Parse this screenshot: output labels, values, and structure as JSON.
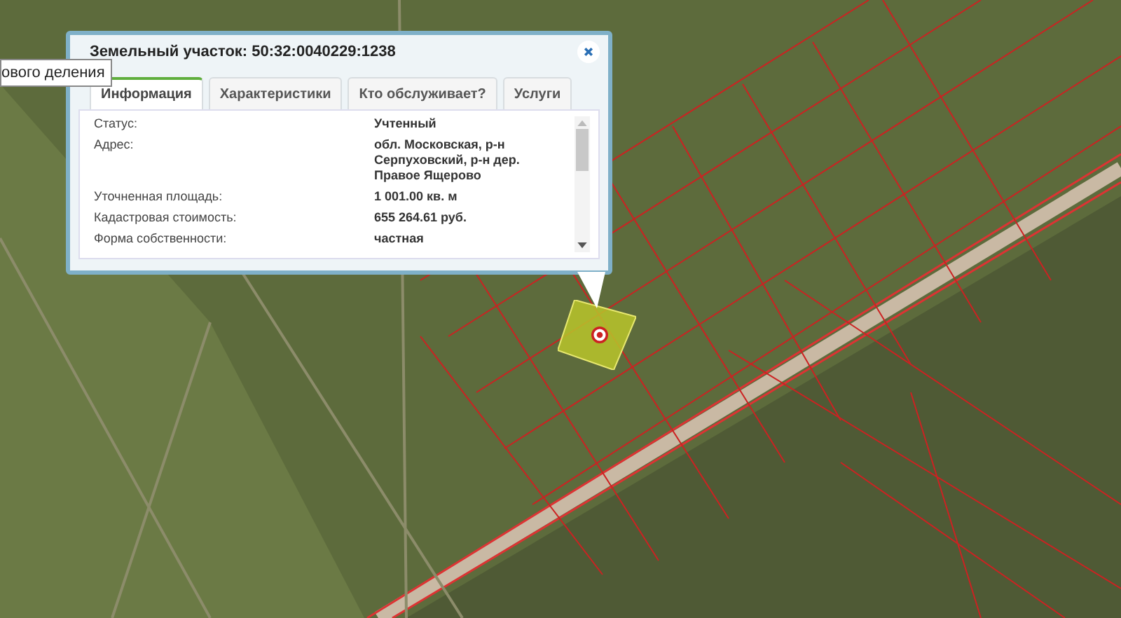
{
  "map_tooltip": {
    "text": "ового деления"
  },
  "popup": {
    "title": "Земельный участок: 50:32:0040229:1238",
    "tabs": [
      {
        "label": "Информация",
        "selected": true
      },
      {
        "label": "Характеристики",
        "selected": false
      },
      {
        "label": "Кто обслуживает?",
        "selected": false
      },
      {
        "label": "Услуги",
        "selected": false
      }
    ],
    "fields": [
      {
        "label": "Статус:",
        "value": [
          "Учтенный"
        ]
      },
      {
        "label": "Адрес:",
        "value": [
          "обл. Московская, р-н",
          "Серпуховский, р-н дер.",
          "Правое Ящерово"
        ]
      },
      {
        "label": "Уточненная площадь:",
        "value": [
          "1 001.00 кв. м"
        ]
      },
      {
        "label": "Кадастровая стоимость:",
        "value": [
          "655 264.61 руб."
        ]
      },
      {
        "label": "Форма собственности:",
        "value": [
          "частная"
        ]
      }
    ]
  }
}
